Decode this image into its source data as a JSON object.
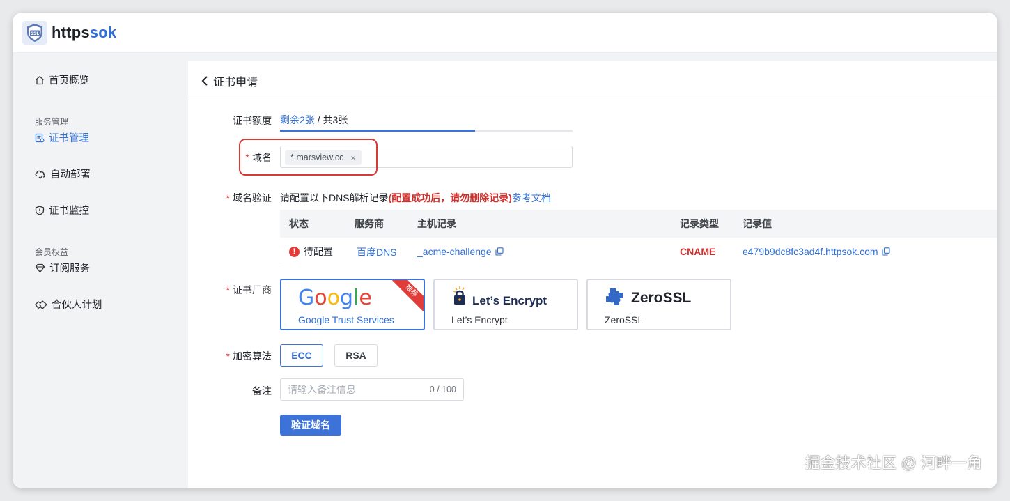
{
  "app": {
    "logo_badge": "SSL",
    "name_part1": "https",
    "name_part2": "sok"
  },
  "sidebar": {
    "items": [
      {
        "label": "首页概览",
        "icon": "home-icon"
      },
      {
        "label": "证书管理",
        "icon": "certificate-icon",
        "active": true
      },
      {
        "label": "自动部署",
        "icon": "deploy-icon"
      },
      {
        "label": "证书监控",
        "icon": "shield-icon"
      },
      {
        "label": "订阅服务",
        "icon": "diamond-icon"
      },
      {
        "label": "合伙人计划",
        "icon": "handshake-icon"
      }
    ],
    "groups": [
      "服务管理",
      "会员权益"
    ]
  },
  "page": {
    "back_icon": "chevron-left-icon",
    "title": "证书申请"
  },
  "form": {
    "quota": {
      "label": "证书额度",
      "remaining": "剩余2张",
      "total": " / 共3张",
      "used_fraction": 0.667
    },
    "domain": {
      "label": "域名",
      "tag": "*.marsview.cc",
      "tag_remove": "×"
    },
    "dns_verify": {
      "label": "域名验证",
      "intro": "请配置以下DNS解析记录",
      "warning": "(配置成功后，请勿删除记录)",
      "doc_link": "参考文档",
      "columns": [
        "状态",
        "服务商",
        "主机记录",
        "记录类型",
        "记录值"
      ],
      "rows": [
        {
          "status": "待配置",
          "provider": "百度DNS",
          "host": "_acme-challenge",
          "type": "CNAME",
          "value": "e479b9dc8fc3ad4f.httpsok.com"
        }
      ]
    },
    "vendor": {
      "label": "证书厂商",
      "options": [
        {
          "logo_text": "Google",
          "caption": "Google Trust Services",
          "badge": "推荐",
          "selected": true
        },
        {
          "logo_text": "Let’s Encrypt",
          "caption": "Let’s Encrypt",
          "selected": false
        },
        {
          "logo_text": "ZeroSSL",
          "caption": "ZeroSSL",
          "selected": false
        }
      ]
    },
    "algorithm": {
      "label": "加密算法",
      "options": [
        "ECC",
        "RSA"
      ],
      "selected": "ECC"
    },
    "remark": {
      "label": "备注",
      "placeholder": "请输入备注信息",
      "counter": "0 / 100"
    },
    "submit_label": "验证域名"
  },
  "watermark": "掘金技术社区 @ 河畔一角",
  "colors": {
    "accent": "#2f6fd6",
    "danger": "#e23c39"
  }
}
